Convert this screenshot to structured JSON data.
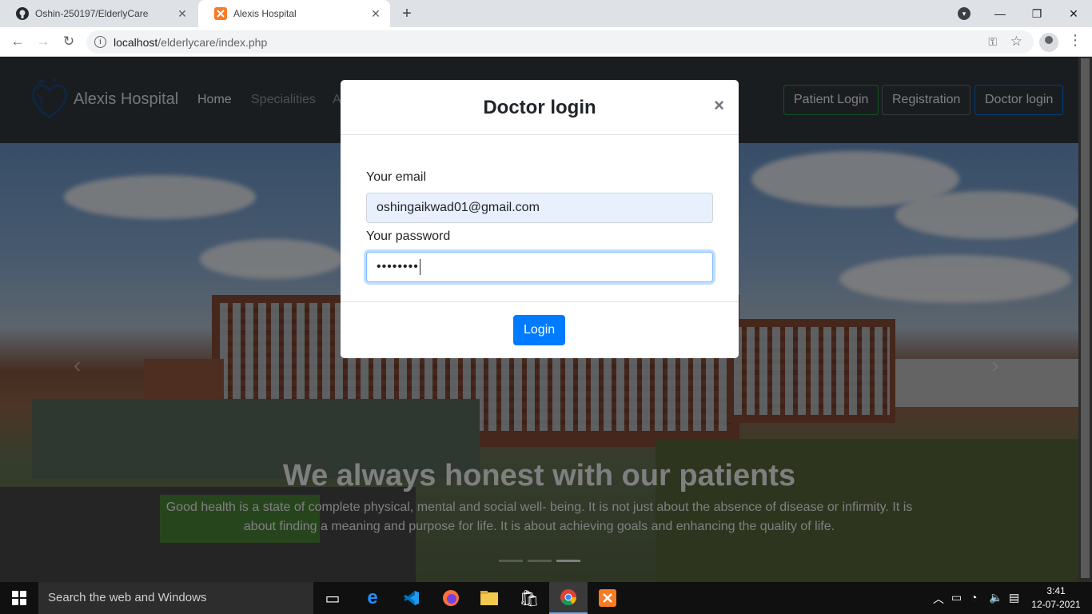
{
  "browser": {
    "tabs": [
      {
        "title": "Oshin-250197/ElderlyCare",
        "icon": "github-icon"
      },
      {
        "title": "Alexis Hospital",
        "icon": "xampp-icon"
      }
    ],
    "url_host": "localhost",
    "url_path": "/elderlycare/index.php"
  },
  "site": {
    "brand": "Alexis Hospital",
    "nav": {
      "home": "Home",
      "specialities": "Specialities",
      "third_partial": "A"
    },
    "buttons": {
      "patient_login": "Patient Login",
      "registration": "Registration",
      "doctor_login": "Doctor login"
    },
    "carousel": {
      "title": "We always honest with our patients",
      "text": "Good health is a state of complete physical, mental and social well- being. It is not just about the absence of disease or infirmity. It is about finding a meaning and purpose for life. It is about achieving goals and enhancing the quality of life.",
      "prev": "‹",
      "next": "›"
    }
  },
  "modal": {
    "title": "Doctor login",
    "close": "×",
    "email_label": "Your email",
    "email_value": "oshingaikwad01@gmail.com",
    "password_label": "Your password",
    "password_mask": "••••••••",
    "submit": "Login"
  },
  "taskbar": {
    "search_placeholder": "Search the web and Windows",
    "time": "3:41",
    "date": "12-07-2021"
  },
  "colors": {
    "primary": "#007bff",
    "navbar": "#343a40",
    "success": "#28a745",
    "secondary": "#6c757d"
  }
}
